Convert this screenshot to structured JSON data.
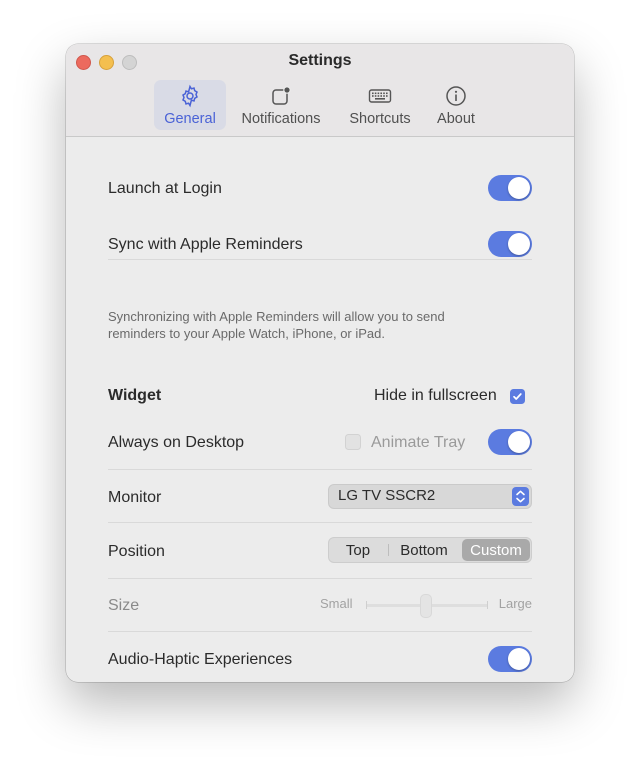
{
  "window": {
    "title": "Settings"
  },
  "tabs": [
    {
      "label": "General",
      "icon": "gear-icon",
      "active": true
    },
    {
      "label": "Notifications",
      "icon": "notification-badge-icon",
      "active": false
    },
    {
      "label": "Shortcuts",
      "icon": "keyboard-icon",
      "active": false
    },
    {
      "label": "About",
      "icon": "info-icon",
      "active": false
    }
  ],
  "general": {
    "launch_at_login": {
      "label": "Launch at Login",
      "enabled": true
    },
    "sync_reminders": {
      "label": "Sync with Apple Reminders",
      "enabled": true,
      "description": "Synchronizing with Apple Reminders will allow you to send reminders to your Apple Watch, iPhone, or iPad."
    }
  },
  "widget": {
    "heading": "Widget",
    "hide_fullscreen": {
      "label": "Hide in fullscreen",
      "checked": true
    },
    "always_on_desktop": {
      "label": "Always on Desktop",
      "enabled": true
    },
    "animate_tray": {
      "label": "Animate Tray",
      "checked": false,
      "disabled": true
    },
    "monitor": {
      "label": "Monitor",
      "value": "LG TV SSCR2"
    },
    "position": {
      "label": "Position",
      "options": [
        "Top",
        "Bottom",
        "Custom"
      ],
      "selected": "Custom"
    },
    "size": {
      "label": "Size",
      "min_label": "Small",
      "max_label": "Large",
      "level": 0.5,
      "disabled": true
    },
    "audio_haptic": {
      "label": "Audio-Haptic Experiences",
      "enabled": true
    }
  },
  "colors": {
    "accent": "#5b7be0",
    "window_bg": "#ececec"
  }
}
